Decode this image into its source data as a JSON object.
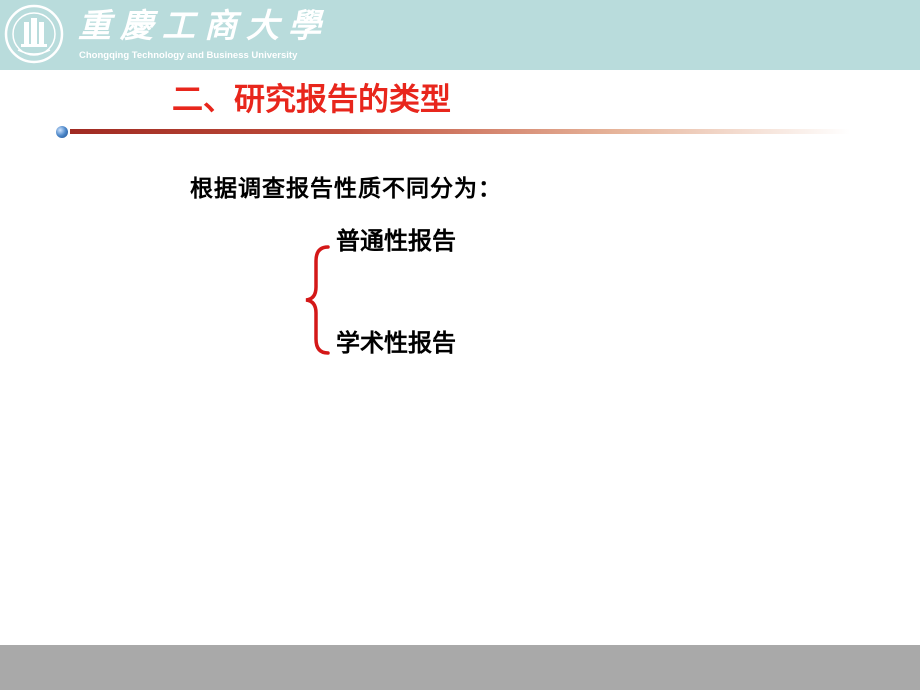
{
  "header": {
    "university_name_cn": "重慶工商大學",
    "university_name_en": "Chongqing Technology and Business University",
    "logo_icon": "university-seal-icon",
    "background_color": "#b9dcdc"
  },
  "slide": {
    "title": "二、研究报告的类型",
    "title_color": "#e8261c",
    "intro": "根据调查报告性质不同分为：",
    "branches": [
      {
        "label": "普通性报告"
      },
      {
        "label": "学术性报告"
      }
    ],
    "brace_icon": "curly-brace-icon",
    "brace_color": "#d41818"
  },
  "footer": {
    "bar_color": "#a9a9a9"
  }
}
